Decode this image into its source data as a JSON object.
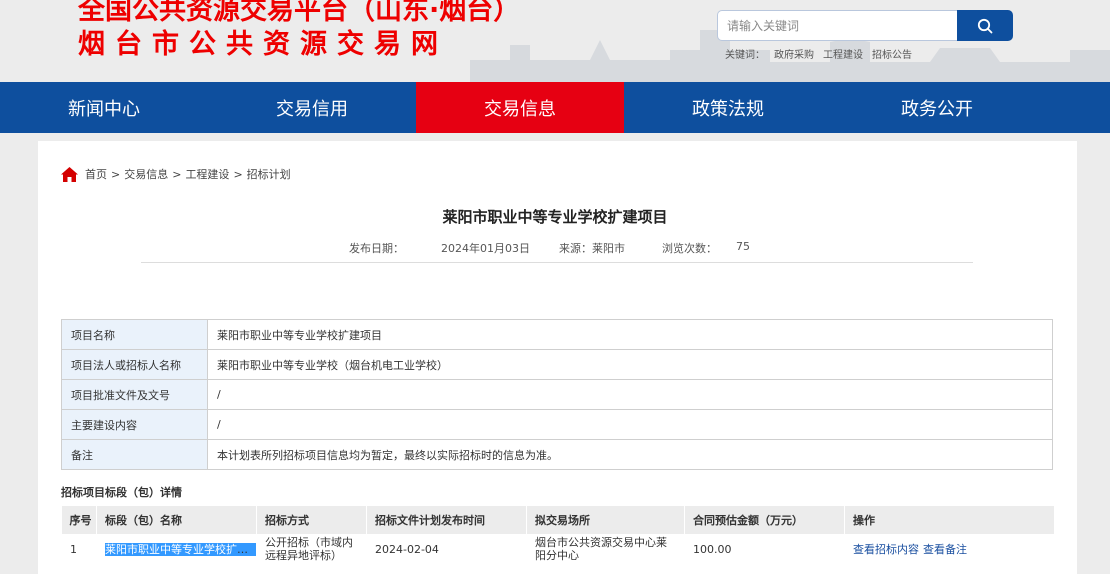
{
  "header": {
    "brand_line1": "全国公共资源交易平台（山东·烟台）",
    "brand_line2": "烟台市公共资源交易网",
    "search": {
      "placeholder": "请输入关键词"
    },
    "keywords_label": "关键词：",
    "keywords": [
      "政府采购",
      "工程建设",
      "招标公告"
    ]
  },
  "nav": {
    "items": [
      {
        "label": "新闻中心",
        "active": false
      },
      {
        "label": "交易信用",
        "active": false
      },
      {
        "label": "交易信息",
        "active": true
      },
      {
        "label": "政策法规",
        "active": false
      },
      {
        "label": "政务公开",
        "active": false
      }
    ]
  },
  "breadcrumb": {
    "items": [
      "首页",
      "交易信息",
      "工程建设",
      "招标计划"
    ],
    "separator": ">"
  },
  "article": {
    "title": "莱阳市职业中等专业学校扩建项目",
    "publish_label": "发布日期：",
    "publish_date": "2024年01月03日",
    "source": "来源：莱阳市",
    "views_label": "浏览次数：",
    "views": "75"
  },
  "info_table": {
    "rows": [
      {
        "label": "项目名称",
        "value": "莱阳市职业中等专业学校扩建项目"
      },
      {
        "label": "项目法人或招标人名称",
        "value": "莱阳市职业中等专业学校（烟台机电工业学校）"
      },
      {
        "label": "项目批准文件及文号",
        "value": "/"
      },
      {
        "label": "主要建设内容",
        "value": "/"
      },
      {
        "label": "备注",
        "value": "本计划表所列招标项目信息均为暂定，最终以实际招标时的信息为准。"
      }
    ]
  },
  "bid_section": {
    "title": "招标项目标段（包）详情",
    "headers": [
      "序号",
      "标段（包）名称",
      "招标方式",
      "招标文件计划发布时间",
      "拟交易场所",
      "合同预估金额（万元）",
      "操作"
    ],
    "rows": [
      {
        "no": "1",
        "name": "莱阳市职业中等专业学校扩建项目",
        "method": "公开招标（市域内远程异地评标）",
        "date": "2024-02-04",
        "place": "烟台市公共资源交易中心莱阳分中心",
        "amount": "100.00",
        "op1": "查看招标内容",
        "op2": "查看备注"
      }
    ]
  },
  "colors": {
    "brand_red": "#e00000",
    "nav_blue": "#0e4f9e",
    "nav_active_red": "#e60012",
    "label_cell_bg": "#eaf2fb",
    "selection_blue": "#3399ff"
  }
}
